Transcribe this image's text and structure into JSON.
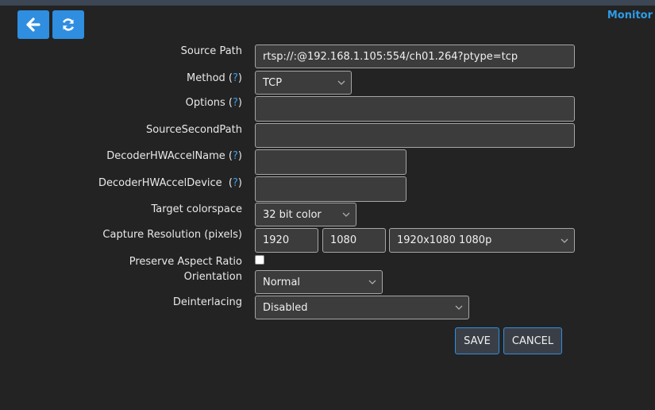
{
  "header": {
    "monitor_link": "Monitor",
    "back_icon": "arrow-left-icon",
    "refresh_icon": "refresh-icon"
  },
  "form": {
    "source_path": {
      "label": "Source Path",
      "value": "rtsp://:@192.168.1.105:554/ch01.264?ptype=tcp"
    },
    "method": {
      "label": "Method",
      "help": "?",
      "value": "TCP"
    },
    "options": {
      "label": "Options",
      "help": "?",
      "value": ""
    },
    "source_second_path": {
      "label": "SourceSecondPath",
      "value": ""
    },
    "decoder_hw_accel_name": {
      "label": "DecoderHWAccelName",
      "help": "?",
      "value": ""
    },
    "decoder_hw_accel_device": {
      "label": "DecoderHWAccelDevice ",
      "help": "?",
      "value": ""
    },
    "target_colorspace": {
      "label": "Target colorspace",
      "value": "32 bit color"
    },
    "capture_resolution": {
      "label": "Capture Resolution (pixels)",
      "width": "1920",
      "height": "1080",
      "preset": "1920x1080 1080p"
    },
    "preserve_aspect_ratio": {
      "label": "Preserve Aspect Ratio",
      "checked": false
    },
    "orientation": {
      "label": "Orientation",
      "value": "Normal"
    },
    "deinterlacing": {
      "label": "Deinterlacing",
      "value": "Disabled"
    }
  },
  "actions": {
    "save": "SAVE",
    "cancel": "CANCEL"
  },
  "colors": {
    "accent": "#2f8ee0",
    "background": "#232323",
    "field_bg": "#3c3c3c"
  }
}
